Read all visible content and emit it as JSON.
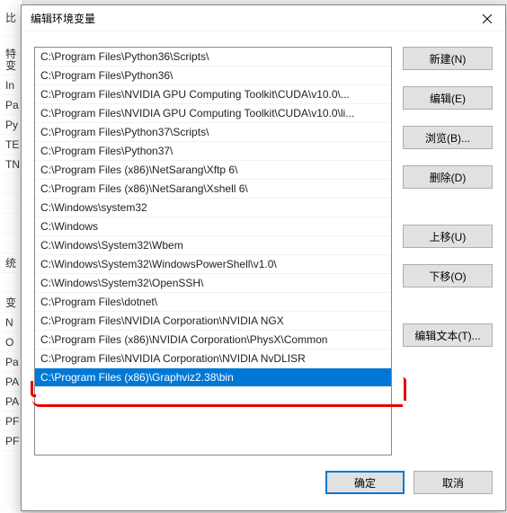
{
  "bg_labels": [
    "比特",
    "",
    "变",
    "In",
    "Pa",
    "Py",
    "TE",
    "TN",
    "",
    "",
    "",
    "",
    "统",
    "",
    "变",
    "N",
    "O",
    "Pa",
    "PA",
    "PA",
    "PF",
    "PF"
  ],
  "dialog": {
    "title": "编辑环境变量"
  },
  "paths": [
    "C:\\Program Files\\Python36\\Scripts\\",
    "C:\\Program Files\\Python36\\",
    "C:\\Program Files\\NVIDIA GPU Computing Toolkit\\CUDA\\v10.0\\...",
    "C:\\Program Files\\NVIDIA GPU Computing Toolkit\\CUDA\\v10.0\\li...",
    "C:\\Program Files\\Python37\\Scripts\\",
    "C:\\Program Files\\Python37\\",
    "C:\\Program Files (x86)\\NetSarang\\Xftp 6\\",
    "C:\\Program Files (x86)\\NetSarang\\Xshell 6\\",
    "C:\\Windows\\system32",
    "C:\\Windows",
    "C:\\Windows\\System32\\Wbem",
    "C:\\Windows\\System32\\WindowsPowerShell\\v1.0\\",
    "C:\\Windows\\System32\\OpenSSH\\",
    "C:\\Program Files\\dotnet\\",
    "C:\\Program Files\\NVIDIA Corporation\\NVIDIA NGX",
    "C:\\Program Files (x86)\\NVIDIA Corporation\\PhysX\\Common",
    "C:\\Program Files\\NVIDIA Corporation\\NVIDIA NvDLISR",
    "C:\\Program Files (x86)\\Graphviz2.38\\bin"
  ],
  "selected_index": 17,
  "buttons": {
    "new": "新建(N)",
    "edit": "编辑(E)",
    "browse": "浏览(B)...",
    "delete": "删除(D)",
    "moveup": "上移(U)",
    "movedown": "下移(O)",
    "edittext": "编辑文本(T)...",
    "ok": "确定",
    "cancel": "取消"
  }
}
